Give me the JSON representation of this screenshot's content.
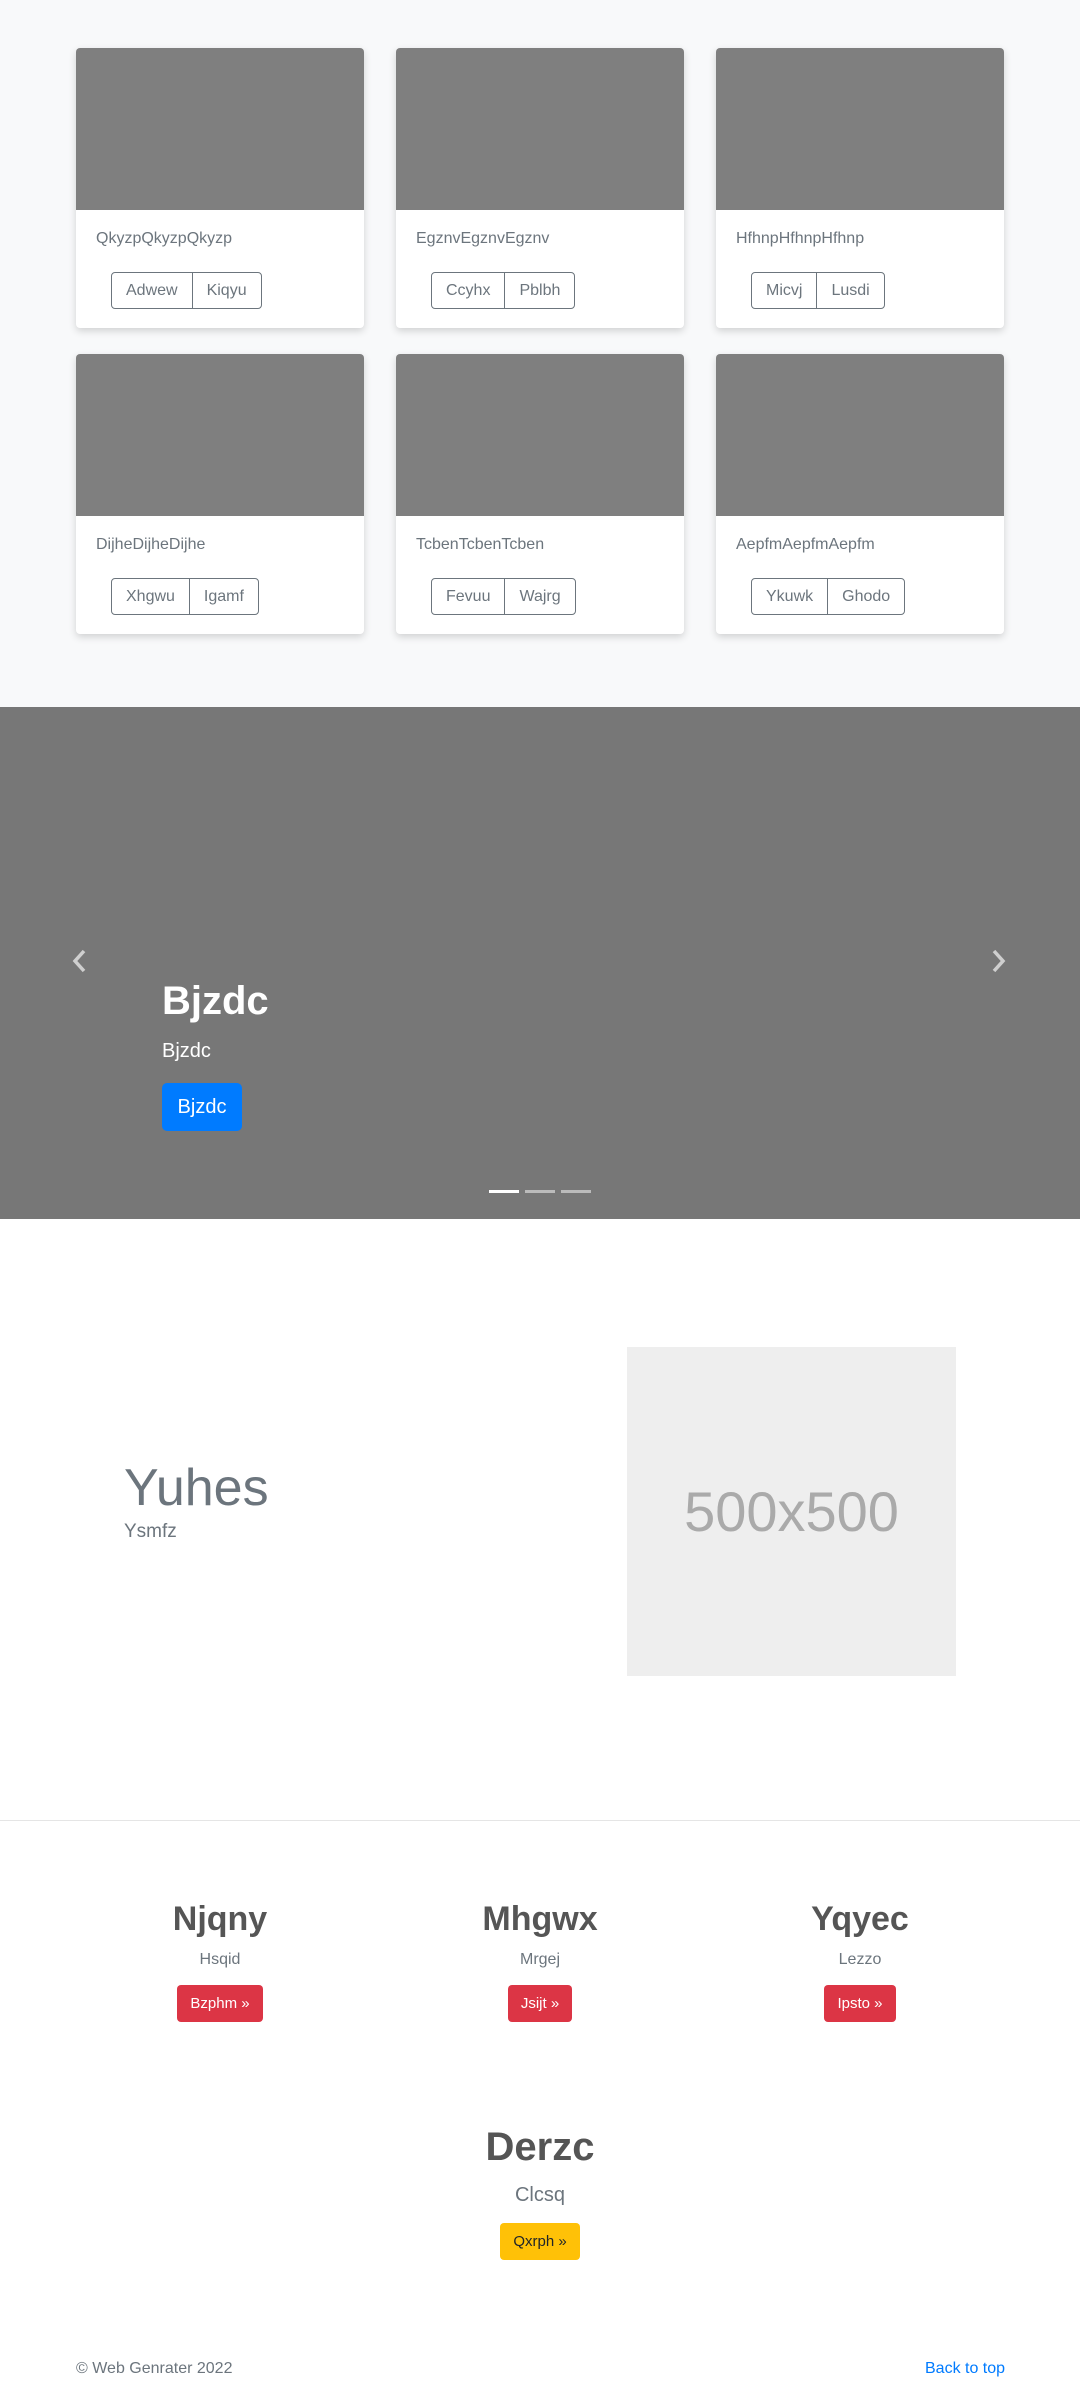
{
  "album": {
    "cards": [
      {
        "text": "QkyzpQkyzpQkyzp",
        "buttons": [
          "Adwew",
          "Kiqyu"
        ]
      },
      {
        "text": "EgznvEgznvEgznv",
        "buttons": [
          "Ccyhx",
          "Pblbh"
        ]
      },
      {
        "text": "HfhnpHfhnpHfhnp",
        "buttons": [
          "Micvj",
          "Lusdi"
        ]
      },
      {
        "text": "DijheDijheDijhe",
        "buttons": [
          "Xhgwu",
          "Igamf"
        ]
      },
      {
        "text": "TcbenTcbenTcben",
        "buttons": [
          "Fevuu",
          "Wajrg"
        ]
      },
      {
        "text": "AepfmAepfmAepfm",
        "buttons": [
          "Ykuwk",
          "Ghodo"
        ]
      }
    ]
  },
  "carousel": {
    "title": "Bjzdc",
    "subtitle": "Bjzdc",
    "button_label": "Bjzdc",
    "prev_icon": "chevron-left-icon",
    "next_icon": "chevron-right-icon",
    "indicator_count": 3,
    "active_indicator": 0
  },
  "featurette": {
    "heading": "Yuhes",
    "lead": "Ysmfz",
    "image_label": "500x500"
  },
  "marketing": {
    "columns": [
      {
        "heading": "Njqny",
        "text": "Hsqid",
        "button": "Bzphm »"
      },
      {
        "heading": "Mhgwx",
        "text": "Mrgej",
        "button": "Jsijt »"
      },
      {
        "heading": "Yqyec",
        "text": "Lezzo",
        "button": "Ipsto »"
      }
    ],
    "center": {
      "heading": "Derzc",
      "text": "Clcsq",
      "button": "Qxrph »"
    }
  },
  "footer": {
    "copyright": "© Web Genrater 2022",
    "back_to_top": "Back to top"
  },
  "colors": {
    "primary": "#007bff",
    "danger": "#dc3545",
    "warning": "#ffc107",
    "carousel_bg": "#777777",
    "card_thumb": "#7f7f7f"
  }
}
